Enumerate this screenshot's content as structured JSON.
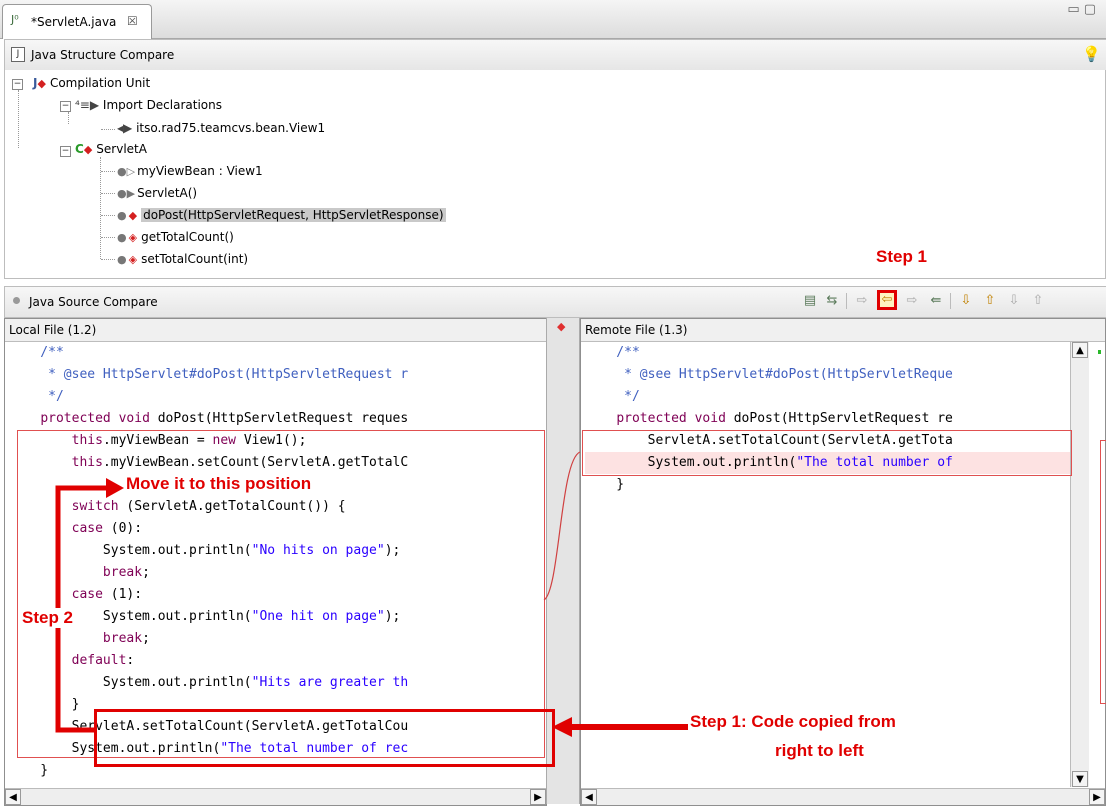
{
  "tab": {
    "title": "*ServletA.java",
    "icon": "java-file-icon",
    "close": "☒"
  },
  "structure": {
    "title": "Java Structure Compare",
    "tree": {
      "root": "Compilation Unit",
      "imports_label": "Import Declarations",
      "import_item": "itso.rad75.teamcvs.bean.View1",
      "class": "ServletA",
      "members": [
        "myViewBean : View1",
        "ServletA()",
        "doPost(HttpServletRequest, HttpServletResponse)",
        "getTotalCount()",
        "setTotalCount(int)"
      ]
    }
  },
  "source": {
    "title": "Java Source Compare",
    "left_header": "Local File (1.2)",
    "right_header": "Remote File (1.3)",
    "left_lines": [
      "    /**",
      "     * @see HttpServlet#doPost(HttpServletRequest r",
      "     */",
      "    protected void doPost(HttpServletRequest reques",
      "        this.myViewBean = new View1();",
      "        this.myViewBean.setCount(ServletA.getTotalC",
      "",
      "        switch (ServletA.getTotalCount()) {",
      "        case (0):",
      "            System.out.println(\"No hits on page\");",
      "            break;",
      "        case (1):",
      "            System.out.println(\"One hit on page\");",
      "            break;",
      "        default:",
      "            System.out.println(\"Hits are greater th",
      "        }",
      "        ServletA.setTotalCount(ServletA.getTotalCou",
      "        System.out.println(\"The total number of rec",
      "    }"
    ],
    "right_lines": [
      "    /**",
      "     * @see HttpServlet#doPost(HttpServletReque",
      "     */",
      "    protected void doPost(HttpServletRequest re",
      "        ServletA.setTotalCount(ServletA.getTota",
      "        System.out.println(\"The total number of",
      "    }"
    ]
  },
  "annotations": {
    "step1_top": "Step 1",
    "move": "Move it to this position",
    "step2": "Step 2",
    "step1_bottom_line1": "Step 1: Code copied from",
    "step1_bottom_line2": "right to left"
  },
  "colors": {
    "annotation_red": "#e00000",
    "change_highlight": "#fde2e2",
    "comment": "#3f5fbf",
    "keyword": "#7f0055",
    "string": "#2a00ff"
  }
}
